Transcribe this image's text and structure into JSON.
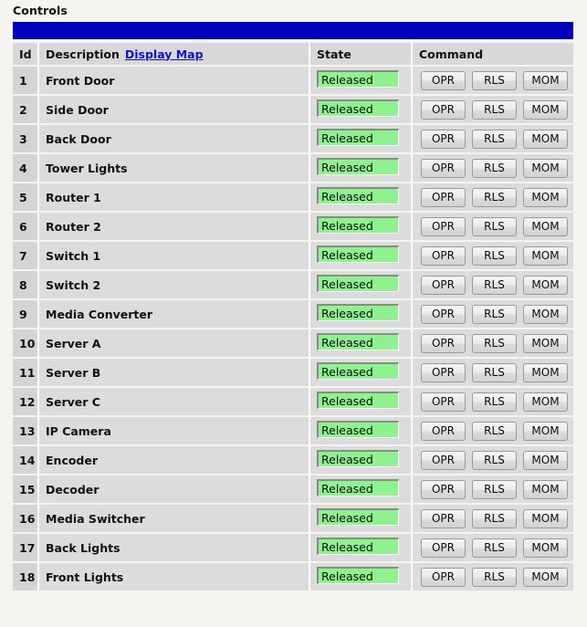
{
  "page": {
    "title": "Controls",
    "accent_bar_color": "#0000bb",
    "background_color": "#f5f4f0",
    "row_color": "#dcdcdc",
    "state_badge_color": "#8ef28e",
    "link_color": "#1111cc"
  },
  "table": {
    "headers": {
      "id": "Id",
      "description": "Description",
      "description_link": "Display Map",
      "state": "State",
      "command": "Command"
    },
    "commands": {
      "operate": "OPR",
      "release": "RLS",
      "momentary": "MOM"
    },
    "rows": [
      {
        "id": "1",
        "description": "Front Door",
        "state": "Released"
      },
      {
        "id": "2",
        "description": "Side Door",
        "state": "Released"
      },
      {
        "id": "3",
        "description": "Back Door",
        "state": "Released"
      },
      {
        "id": "4",
        "description": "Tower Lights",
        "state": "Released"
      },
      {
        "id": "5",
        "description": "Router 1",
        "state": "Released"
      },
      {
        "id": "6",
        "description": "Router 2",
        "state": "Released"
      },
      {
        "id": "7",
        "description": "Switch 1",
        "state": "Released"
      },
      {
        "id": "8",
        "description": "Switch 2",
        "state": "Released"
      },
      {
        "id": "9",
        "description": "Media Converter",
        "state": "Released"
      },
      {
        "id": "10",
        "description": "Server A",
        "state": "Released"
      },
      {
        "id": "11",
        "description": "Server B",
        "state": "Released"
      },
      {
        "id": "12",
        "description": "Server C",
        "state": "Released"
      },
      {
        "id": "13",
        "description": "IP Camera",
        "state": "Released"
      },
      {
        "id": "14",
        "description": "Encoder",
        "state": "Released"
      },
      {
        "id": "15",
        "description": "Decoder",
        "state": "Released"
      },
      {
        "id": "16",
        "description": "Media Switcher",
        "state": "Released"
      },
      {
        "id": "17",
        "description": "Back Lights",
        "state": "Released"
      },
      {
        "id": "18",
        "description": "Front Lights",
        "state": "Released"
      }
    ]
  }
}
